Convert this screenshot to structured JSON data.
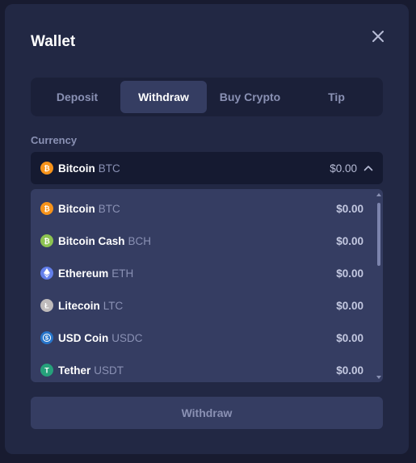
{
  "modal": {
    "title": "Wallet"
  },
  "tabs": [
    {
      "label": "Deposit",
      "active": false
    },
    {
      "label": "Withdraw",
      "active": true
    },
    {
      "label": "Buy Crypto",
      "active": false
    },
    {
      "label": "Tip",
      "active": false
    }
  ],
  "currency": {
    "label": "Currency",
    "selected": {
      "name": "Bitcoin",
      "symbol": "BTC",
      "amount": "$0.00",
      "icon": "bitcoin-icon",
      "color": "#f7931a"
    }
  },
  "currency_list": [
    {
      "name": "Bitcoin",
      "symbol": "BTC",
      "amount": "$0.00",
      "icon": "bitcoin-icon",
      "color": "#f7931a"
    },
    {
      "name": "Bitcoin Cash",
      "symbol": "BCH",
      "amount": "$0.00",
      "icon": "bitcoin-cash-icon",
      "color": "#8dc351"
    },
    {
      "name": "Ethereum",
      "symbol": "ETH",
      "amount": "$0.00",
      "icon": "ethereum-icon",
      "color": "#627eea"
    },
    {
      "name": "Litecoin",
      "symbol": "LTC",
      "amount": "$0.00",
      "icon": "litecoin-icon",
      "color": "#bfbbbb"
    },
    {
      "name": "USD Coin",
      "symbol": "USDC",
      "amount": "$0.00",
      "icon": "usd-coin-icon",
      "color": "#2775ca"
    },
    {
      "name": "Tether",
      "symbol": "USDT",
      "amount": "$0.00",
      "icon": "tether-icon",
      "color": "#26a17b"
    }
  ],
  "actions": {
    "withdraw_label": "Withdraw"
  }
}
